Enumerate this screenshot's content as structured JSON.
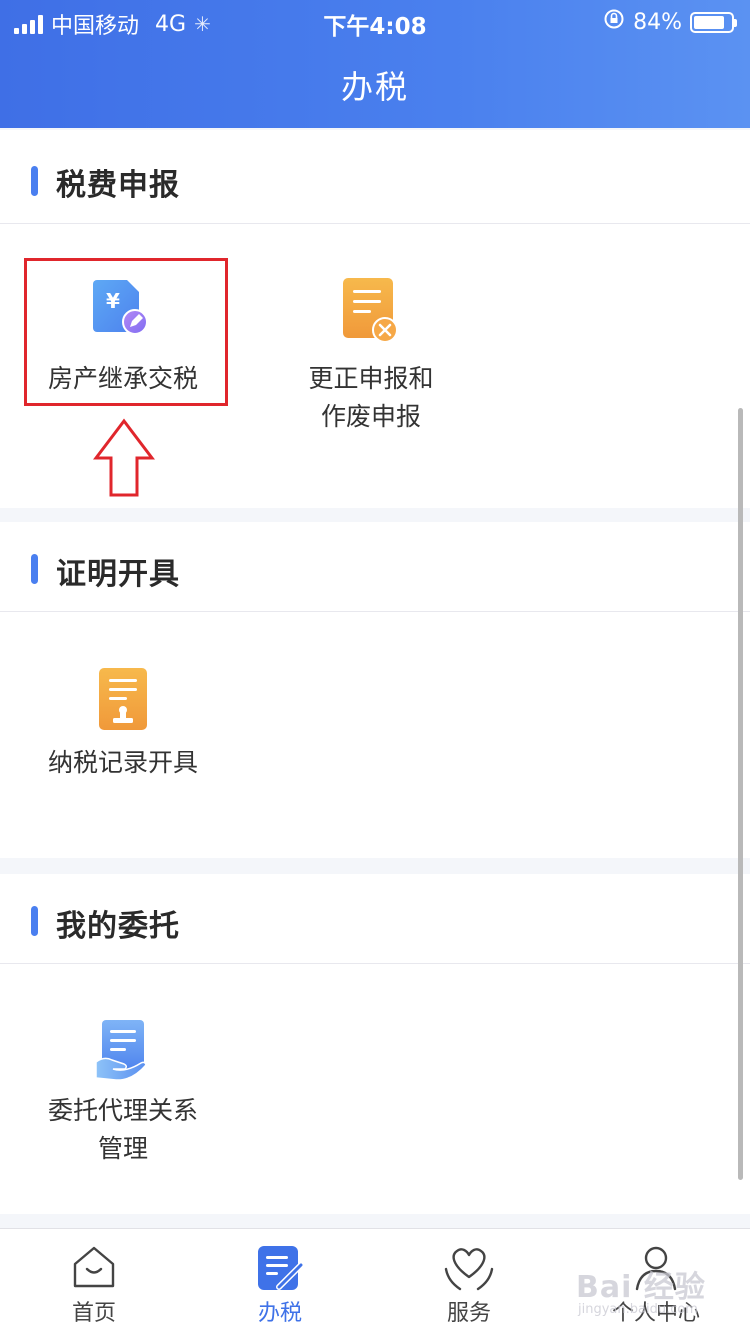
{
  "status_bar": {
    "carrier": "中国移动",
    "network": "4G",
    "time": "下午4:08",
    "battery": "84%",
    "battery_level": 0.84
  },
  "nav": {
    "title": "办税"
  },
  "sections": [
    {
      "title": "税费申报",
      "items": [
        {
          "label_lines": [
            "房产继承交税"
          ],
          "icon": "yuan-document-edit-icon"
        },
        {
          "label_lines": [
            "更正申报和",
            "作废申报"
          ],
          "icon": "document-cancel-icon"
        }
      ]
    },
    {
      "title": "证明开具",
      "items": [
        {
          "label_lines": [
            "纳税记录开具"
          ],
          "icon": "document-stamp-icon"
        }
      ]
    },
    {
      "title": "我的委托",
      "items": [
        {
          "label_lines": [
            "委托代理关系",
            "管理"
          ],
          "icon": "document-hand-icon"
        }
      ]
    }
  ],
  "tabbar": [
    {
      "label": "首页",
      "icon": "home-icon",
      "active": false
    },
    {
      "label": "办税",
      "icon": "tax-document-icon",
      "active": true
    },
    {
      "label": "服务",
      "icon": "heart-hands-icon",
      "active": false
    },
    {
      "label": "个人中心",
      "icon": "user-icon",
      "active": false
    }
  ],
  "watermark": {
    "text": "Bai 经验",
    "sub": "jingyan.baidu.com"
  },
  "colors": {
    "header_blue": "#4a7ff0",
    "accent_blue": "#3f72e8",
    "highlight_red": "#e0262c",
    "icon_orange": "#f2a53a"
  }
}
